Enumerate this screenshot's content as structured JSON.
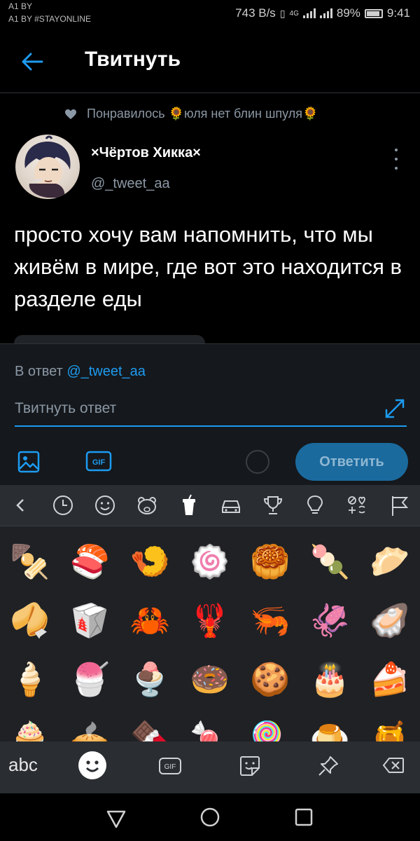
{
  "status_bar": {
    "carrier_line1": "A1 BY",
    "carrier_line2": "A1 BY #STAYONLINE",
    "network_speed": "743 B/s",
    "network_type": "4G",
    "battery": "89%",
    "time": "9:41"
  },
  "header": {
    "title": "Твитнуть",
    "back_icon": "arrow-left-icon"
  },
  "tweet": {
    "liked_by": "Понравилось 🌻юля нет блин шпуля🌻",
    "display_name": "×Чёртов Хикка×",
    "handle": "@_tweet_aa",
    "text": "просто хочу вам напомнить, что мы живём в мире, где вот это находится в разделе еды"
  },
  "composer": {
    "reply_to_prefix": "В ответ",
    "reply_to_handle": "@_tweet_aa",
    "placeholder": "Твитнуть ответ",
    "reply_button": "Ответить",
    "gif_label": "GIF"
  },
  "keyboard": {
    "categories": [
      "chevron-left-icon",
      "clock-icon",
      "smiley-icon",
      "bear-icon",
      "cup-icon",
      "car-icon",
      "trophy-icon",
      "lightbulb-icon",
      "symbols-icon",
      "flag-icon"
    ],
    "emoji_rows": [
      [
        "🍢",
        "🍣",
        "🍤",
        "🍥",
        "🥮",
        "🍡",
        "🥟"
      ],
      [
        "🥠",
        "🥡",
        "🦀",
        "🦞",
        "🦐",
        "🦑",
        "🦪"
      ],
      [
        "🍦",
        "🍧",
        "🍨",
        "🍩",
        "🍪",
        "🎂",
        "🍰"
      ],
      [
        "🧁",
        "🥧",
        "🍫",
        "🍬",
        "🍭",
        "🍮",
        "🍯"
      ]
    ],
    "abc_key": "abc",
    "gif_key": "GIF"
  },
  "colors": {
    "accent": "#1d9bf0",
    "background": "#000000",
    "keyboard_bg": "#1f2125"
  }
}
